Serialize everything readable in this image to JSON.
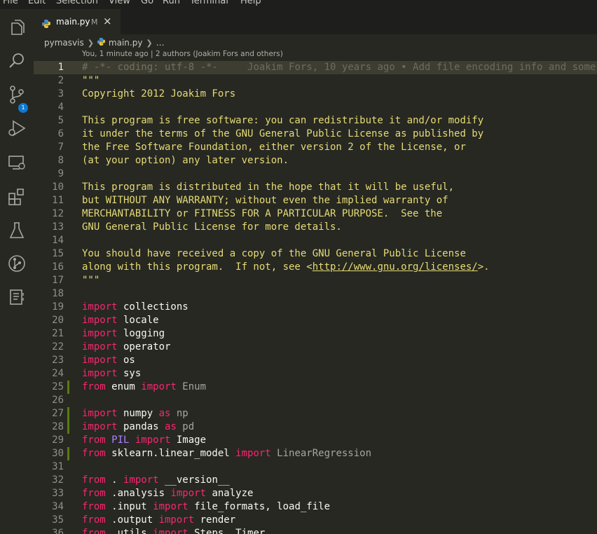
{
  "menu": [
    "File",
    "Edit",
    "Selection",
    "View",
    "Go",
    "Run",
    "Terminal",
    "Help"
  ],
  "activity_bar": {
    "icons": [
      "explorer-icon",
      "search-icon",
      "source-control-icon",
      "run-debug-icon",
      "remote-explorer-icon",
      "extensions-icon",
      "testing-icon",
      "git-graph-icon",
      "notebook-icon"
    ],
    "scm_badge": "1"
  },
  "tab": {
    "label": "main.py",
    "badge": "M",
    "close": "×"
  },
  "breadcrumb": {
    "folder": "pymasvis",
    "file": "main.py",
    "symbol": "…"
  },
  "codelens": "You, 1 minute ago | 2 authors (Joakim Fors and others)",
  "blame": "Joakim Fors, 10 years ago • Add file encoding info and some",
  "lines": [
    {
      "n": "1",
      "active": true,
      "tokens": [
        [
          "com",
          "# -*- coding: utf-8 -*-"
        ]
      ]
    },
    {
      "n": "2",
      "tokens": [
        [
          "str",
          "\"\"\""
        ]
      ]
    },
    {
      "n": "3",
      "tokens": [
        [
          "str",
          "Copyright 2012 Joakim Fors"
        ]
      ]
    },
    {
      "n": "4",
      "tokens": []
    },
    {
      "n": "5",
      "tokens": [
        [
          "str",
          "This program is free software: you can redistribute it and/or modify"
        ]
      ]
    },
    {
      "n": "6",
      "tokens": [
        [
          "str",
          "it under the terms of the GNU General Public License as published by"
        ]
      ]
    },
    {
      "n": "7",
      "tokens": [
        [
          "str",
          "the Free Software Foundation, either version 2 of the License, or"
        ]
      ]
    },
    {
      "n": "8",
      "tokens": [
        [
          "str",
          "(at your option) any later version."
        ]
      ]
    },
    {
      "n": "9",
      "tokens": []
    },
    {
      "n": "10",
      "tokens": [
        [
          "str",
          "This program is distributed in the hope that it will be useful,"
        ]
      ]
    },
    {
      "n": "11",
      "tokens": [
        [
          "str",
          "but WITHOUT ANY WARRANTY; without even the implied warranty of"
        ]
      ]
    },
    {
      "n": "12",
      "tokens": [
        [
          "str",
          "MERCHANTABILITY or FITNESS FOR A PARTICULAR PURPOSE.  See the"
        ]
      ]
    },
    {
      "n": "13",
      "tokens": [
        [
          "str",
          "GNU General Public License for more details."
        ]
      ]
    },
    {
      "n": "14",
      "tokens": []
    },
    {
      "n": "15",
      "tokens": [
        [
          "str",
          "You should have received a copy of the GNU General Public License"
        ]
      ]
    },
    {
      "n": "16",
      "tokens": [
        [
          "str",
          "along with this program.  If not, see <"
        ],
        [
          "link",
          "http://www.gnu.org/licenses/"
        ],
        [
          "str",
          ">."
        ]
      ]
    },
    {
      "n": "17",
      "tokens": [
        [
          "str",
          "\"\"\""
        ]
      ]
    },
    {
      "n": "18",
      "tokens": []
    },
    {
      "n": "19",
      "tokens": [
        [
          "kw",
          "import"
        ],
        [
          "id",
          " collections"
        ]
      ]
    },
    {
      "n": "20",
      "tokens": [
        [
          "kw",
          "import"
        ],
        [
          "id",
          " locale"
        ]
      ]
    },
    {
      "n": "21",
      "tokens": [
        [
          "kw",
          "import"
        ],
        [
          "id",
          " logging"
        ]
      ]
    },
    {
      "n": "22",
      "tokens": [
        [
          "kw",
          "import"
        ],
        [
          "id",
          " operator"
        ]
      ]
    },
    {
      "n": "23",
      "tokens": [
        [
          "kw",
          "import"
        ],
        [
          "id",
          " os"
        ]
      ]
    },
    {
      "n": "24",
      "tokens": [
        [
          "kw",
          "import"
        ],
        [
          "id",
          " sys"
        ]
      ]
    },
    {
      "n": "25",
      "mark": true,
      "tokens": [
        [
          "kw",
          "from"
        ],
        [
          "id",
          " enum "
        ],
        [
          "kw",
          "import"
        ],
        [
          "mod",
          " Enum"
        ]
      ]
    },
    {
      "n": "26",
      "tokens": []
    },
    {
      "n": "27",
      "mark": true,
      "tokens": [
        [
          "kw",
          "import"
        ],
        [
          "id",
          " numpy "
        ],
        [
          "kw",
          "as"
        ],
        [
          "mod",
          " np"
        ]
      ]
    },
    {
      "n": "28",
      "mark": true,
      "tokens": [
        [
          "kw",
          "import"
        ],
        [
          "id",
          " pandas "
        ],
        [
          "kw",
          "as"
        ],
        [
          "mod",
          " pd"
        ]
      ]
    },
    {
      "n": "29",
      "tokens": [
        [
          "kw",
          "from"
        ],
        [
          "cls",
          " PIL"
        ],
        [
          "kw",
          " import"
        ],
        [
          "id",
          " Image"
        ]
      ]
    },
    {
      "n": "30",
      "mark": true,
      "tokens": [
        [
          "kw",
          "from"
        ],
        [
          "id",
          " sklearn.linear_model "
        ],
        [
          "kw",
          "import"
        ],
        [
          "mod",
          " LinearRegression"
        ]
      ]
    },
    {
      "n": "31",
      "tokens": []
    },
    {
      "n": "32",
      "tokens": [
        [
          "kw",
          "from"
        ],
        [
          "id",
          " . "
        ],
        [
          "kw",
          "import"
        ],
        [
          "id",
          " __version__"
        ]
      ]
    },
    {
      "n": "33",
      "tokens": [
        [
          "kw",
          "from"
        ],
        [
          "id",
          " .analysis "
        ],
        [
          "kw",
          "import"
        ],
        [
          "id",
          " analyze"
        ]
      ]
    },
    {
      "n": "34",
      "tokens": [
        [
          "kw",
          "from"
        ],
        [
          "id",
          " .input "
        ],
        [
          "kw",
          "import"
        ],
        [
          "id",
          " file_formats, load_file"
        ]
      ]
    },
    {
      "n": "35",
      "tokens": [
        [
          "kw",
          "from"
        ],
        [
          "id",
          " .output "
        ],
        [
          "kw",
          "import"
        ],
        [
          "id",
          " render"
        ]
      ]
    },
    {
      "n": "36",
      "tokens": [
        [
          "kw",
          "from"
        ],
        [
          "id",
          " .utils "
        ],
        [
          "kw",
          "import"
        ],
        [
          "id",
          " Steps, Timer"
        ]
      ]
    }
  ]
}
